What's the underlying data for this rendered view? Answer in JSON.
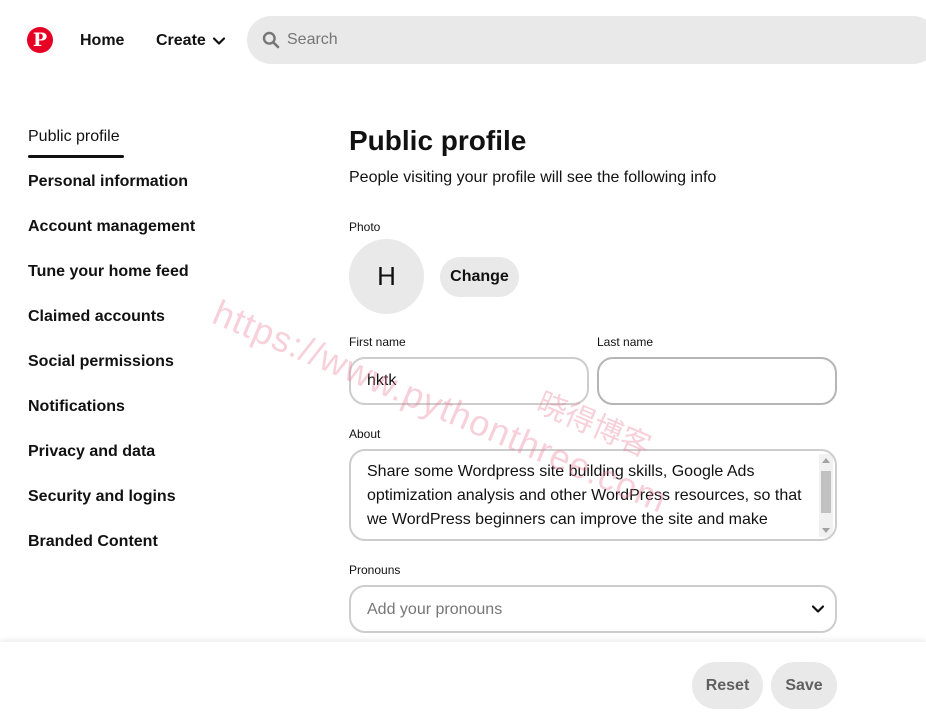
{
  "header": {
    "nav_home": "Home",
    "nav_create": "Create",
    "search_placeholder": "Search"
  },
  "sidebar": {
    "items": [
      {
        "label": "Public profile",
        "active": true
      },
      {
        "label": "Personal information"
      },
      {
        "label": "Account management"
      },
      {
        "label": "Tune your home feed"
      },
      {
        "label": "Claimed accounts"
      },
      {
        "label": "Social permissions"
      },
      {
        "label": "Notifications"
      },
      {
        "label": "Privacy and data"
      },
      {
        "label": "Security and logins"
      },
      {
        "label": "Branded Content"
      }
    ]
  },
  "main": {
    "title": "Public profile",
    "subtitle": "People visiting your profile will see the following info",
    "photo_label": "Photo",
    "avatar_initial": "H",
    "change_button": "Change",
    "first_name_label": "First name",
    "first_name_value": "hktk",
    "last_name_label": "Last name",
    "last_name_value": "",
    "about_label": "About",
    "about_value": "Share some Wordpress site building skills, Google Ads optimization analysis and other WordPress resources, so that we WordPress beginners can improve the site and make",
    "pronouns_label": "Pronouns",
    "pronouns_placeholder": "Add your pronouns"
  },
  "footer": {
    "reset_button": "Reset",
    "save_button": "Save"
  },
  "watermark": {
    "url": "https://www.pythonthree.com",
    "cn": "晓得博客"
  },
  "colors": {
    "brand": "#e60023",
    "button_bg": "#e9e9e9",
    "text": "#111111"
  }
}
